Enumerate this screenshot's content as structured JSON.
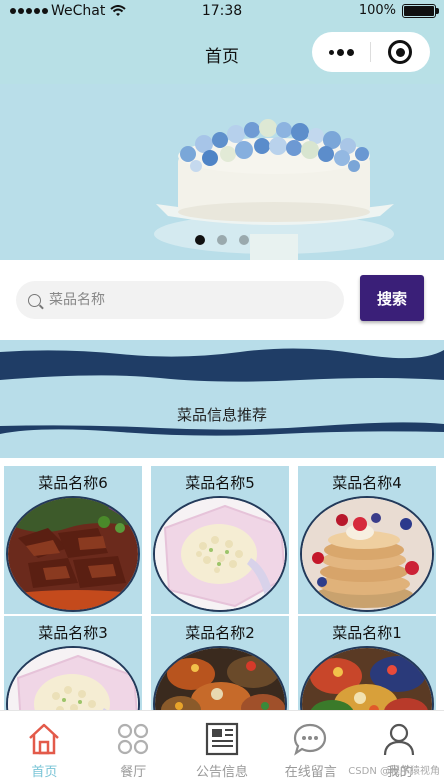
{
  "status_bar": {
    "carrier": "WeChat",
    "time": "17:38",
    "battery": "100%"
  },
  "nav": {
    "title": "首页"
  },
  "banner": {
    "slide_count": 3,
    "active_slide": 1
  },
  "search": {
    "placeholder": "菜品名称",
    "value": "",
    "button_label": "搜索"
  },
  "recommend": {
    "title": "菜品信息推荐"
  },
  "dishes": [
    {
      "name": "菜品名称6",
      "photo": "braised-meat"
    },
    {
      "name": "菜品名称5",
      "photo": "fried-rice"
    },
    {
      "name": "菜品名称4",
      "photo": "pancakes"
    },
    {
      "name": "菜品名称3",
      "photo": "fried-rice"
    },
    {
      "name": "菜品名称2",
      "photo": "seafood-platter"
    },
    {
      "name": "菜品名称1",
      "photo": "seafood-platter"
    }
  ],
  "tabs": [
    {
      "label": "首页",
      "icon": "home-icon",
      "active": true
    },
    {
      "label": "餐厅",
      "icon": "grid-icon",
      "active": false
    },
    {
      "label": "公告信息",
      "icon": "news-icon",
      "active": false
    },
    {
      "label": "在线留言",
      "icon": "chat-icon",
      "active": false
    },
    {
      "label": "我的",
      "icon": "user-icon",
      "active": false
    }
  ],
  "watermark": "CSDN @程序猿视角",
  "colors": {
    "theme": "#b8dde9",
    "accent": "#3a1f78",
    "active_tab": "#79c4d6"
  }
}
